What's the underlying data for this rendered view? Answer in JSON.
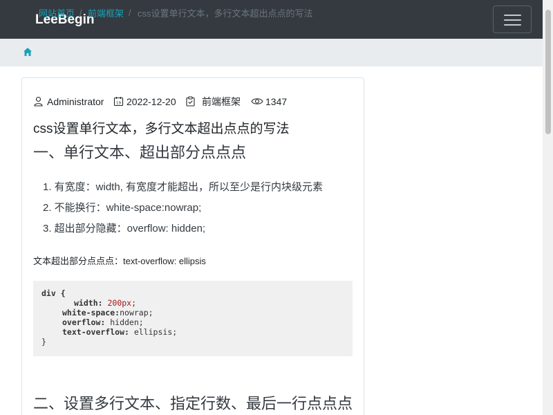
{
  "navbar": {
    "brand": "LeeBegin"
  },
  "breadcrumb": {
    "items": [
      "网站首页",
      "前端框架",
      "css设置单行文本，多行文本超出点点的写法"
    ],
    "separator": "/"
  },
  "article": {
    "author": "Administrator",
    "date": "2022-12-20",
    "category": "前端框架",
    "views": "1347",
    "title": "css设置单行文本，多行文本超出点点的写法",
    "section1": "一、单行文本、超出部分点点点",
    "list": [
      "1. 有宽度：width, 有宽度才能超出，所以至少是行内块级元素",
      "2. 不能换行：white-space:nowrap;",
      "3. 超出部分隐藏：overflow: hidden;"
    ],
    "paragraph": "文本超出部分点点点：text-overflow: ellipsis",
    "code": {
      "l1": "div {",
      "l2_prop": "width:",
      "l2_val": "200px",
      "l2_end": ";",
      "l3_prop": "white-space:",
      "l3_val": "nowrap;",
      "l4_prop": "overflow:",
      "l4_val": " hidden;",
      "l5_prop": "text-overflow:",
      "l5_val": " ellipsis;",
      "l6": "}"
    },
    "section2": "二、设置多行文本、指定行数、最后一行点点点"
  },
  "colors": {
    "navbar": "#343a40",
    "link": "#17a2b8",
    "breadcrumb_bg": "#e9ecef",
    "code_bg": "#f0f0f0"
  }
}
